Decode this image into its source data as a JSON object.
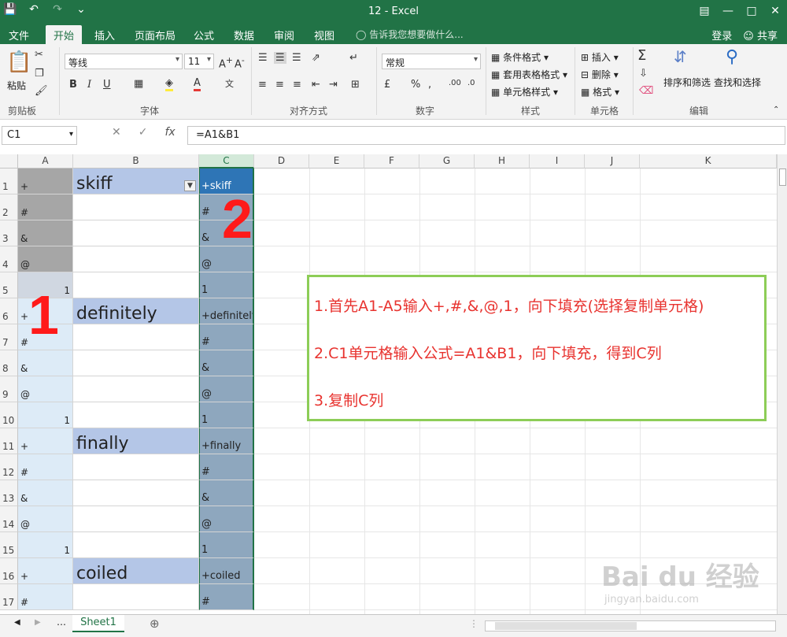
{
  "window": {
    "title": "12 - Excel"
  },
  "qat": {
    "save_icon": "save-icon",
    "undo_icon": "undo-icon",
    "redo_icon": "redo-icon"
  },
  "tabs": [
    "文件",
    "开始",
    "插入",
    "页面布局",
    "公式",
    "数据",
    "审阅",
    "视图"
  ],
  "active_tab": "开始",
  "tell_me": "告诉我您想要做什么...",
  "account": {
    "login": "登录",
    "share": "共享"
  },
  "ribbon": {
    "clipboard": {
      "paste": "粘贴",
      "label": "剪贴板"
    },
    "font": {
      "name": "等线",
      "size": "11",
      "bold": "B",
      "italic": "I",
      "underline": "U",
      "label": "字体"
    },
    "alignment": {
      "label": "对齐方式"
    },
    "number": {
      "format": "常规",
      "label": "数字"
    },
    "styles": {
      "conditional": "条件格式",
      "table": "套用表格格式",
      "cell": "单元格样式",
      "label": "样式"
    },
    "cells": {
      "insert": "插入",
      "delete": "删除",
      "format": "格式",
      "label": "单元格"
    },
    "editing": {
      "sort": "排序和筛选",
      "find": "查找和选择",
      "label": "编辑"
    }
  },
  "formula_bar": {
    "name_box": "C1",
    "fx": "fx",
    "formula": "=A1&B1"
  },
  "columns": [
    "A",
    "B",
    "C",
    "D",
    "E",
    "F",
    "G",
    "H",
    "I",
    "J",
    "K"
  ],
  "rows": [
    {
      "n": "1",
      "a": "+",
      "b": "skiff",
      "c": "+skiff"
    },
    {
      "n": "2",
      "a": "#",
      "b": "",
      "c": "#"
    },
    {
      "n": "3",
      "a": "&",
      "b": "",
      "c": "&"
    },
    {
      "n": "4",
      "a": "@",
      "b": "",
      "c": "@"
    },
    {
      "n": "5",
      "a": "1",
      "b": "",
      "c": "1"
    },
    {
      "n": "6",
      "a": "+",
      "b": "definitely",
      "c": "+definitely"
    },
    {
      "n": "7",
      "a": "#",
      "b": "",
      "c": "#"
    },
    {
      "n": "8",
      "a": "&",
      "b": "",
      "c": "&"
    },
    {
      "n": "9",
      "a": "@",
      "b": "",
      "c": "@"
    },
    {
      "n": "10",
      "a": "1",
      "b": "",
      "c": "1"
    },
    {
      "n": "11",
      "a": "+",
      "b": "finally",
      "c": "+finally"
    },
    {
      "n": "12",
      "a": "#",
      "b": "",
      "c": "#"
    },
    {
      "n": "13",
      "a": "&",
      "b": "",
      "c": "&"
    },
    {
      "n": "14",
      "a": "@",
      "b": "",
      "c": "@"
    },
    {
      "n": "15",
      "a": "1",
      "b": "",
      "c": "1"
    },
    {
      "n": "16",
      "a": "+",
      "b": "coiled",
      "c": "+coiled"
    },
    {
      "n": "17",
      "a": "#",
      "b": "",
      "c": "#"
    }
  ],
  "annotations": {
    "label1": "1",
    "label2": "2"
  },
  "callout": {
    "step1": "1.首先A1-A5输入+,#,&,@,1，向下填充(选择复制单元格)",
    "step2": "2.C1单元格输入公式=A1&B1，向下填充，得到C列",
    "step3": "3.复制C列"
  },
  "sheet_tabs": [
    "Sheet1"
  ],
  "watermark": {
    "brand": "Bai du 经验",
    "url": "jingyan.baidu.com"
  },
  "colors": {
    "excel_green": "#217346",
    "selected_column": "#8ea7be",
    "header_row_fill": "#b4c6e7",
    "annotation_red": "#ff1a1a",
    "callout_border": "#8dcd57"
  }
}
